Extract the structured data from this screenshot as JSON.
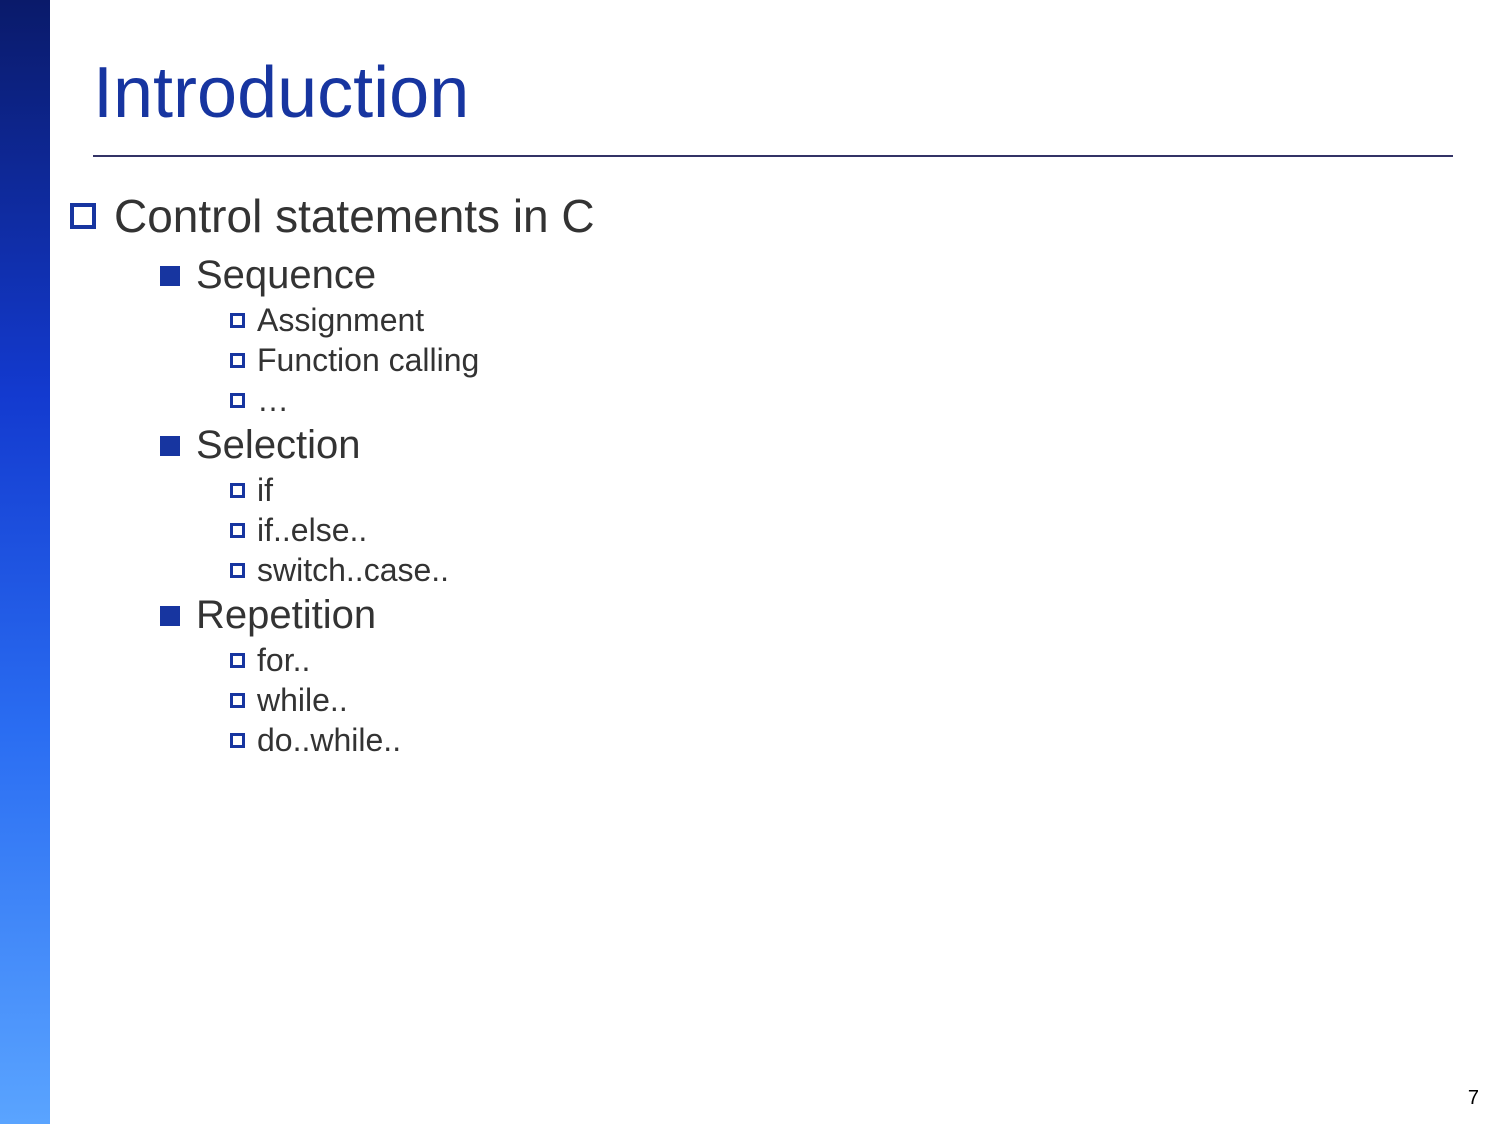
{
  "title": "Introduction",
  "page_number": "7",
  "outline": {
    "level1": "Control statements in C",
    "groups": [
      {
        "heading": "Sequence",
        "items": [
          "Assignment",
          "Function calling",
          "…"
        ]
      },
      {
        "heading": "Selection",
        "items": [
          "if",
          "if..else..",
          "switch..case.."
        ]
      },
      {
        "heading": "Repetition",
        "items": [
          "for..",
          "while..",
          "do..while.."
        ]
      }
    ]
  }
}
